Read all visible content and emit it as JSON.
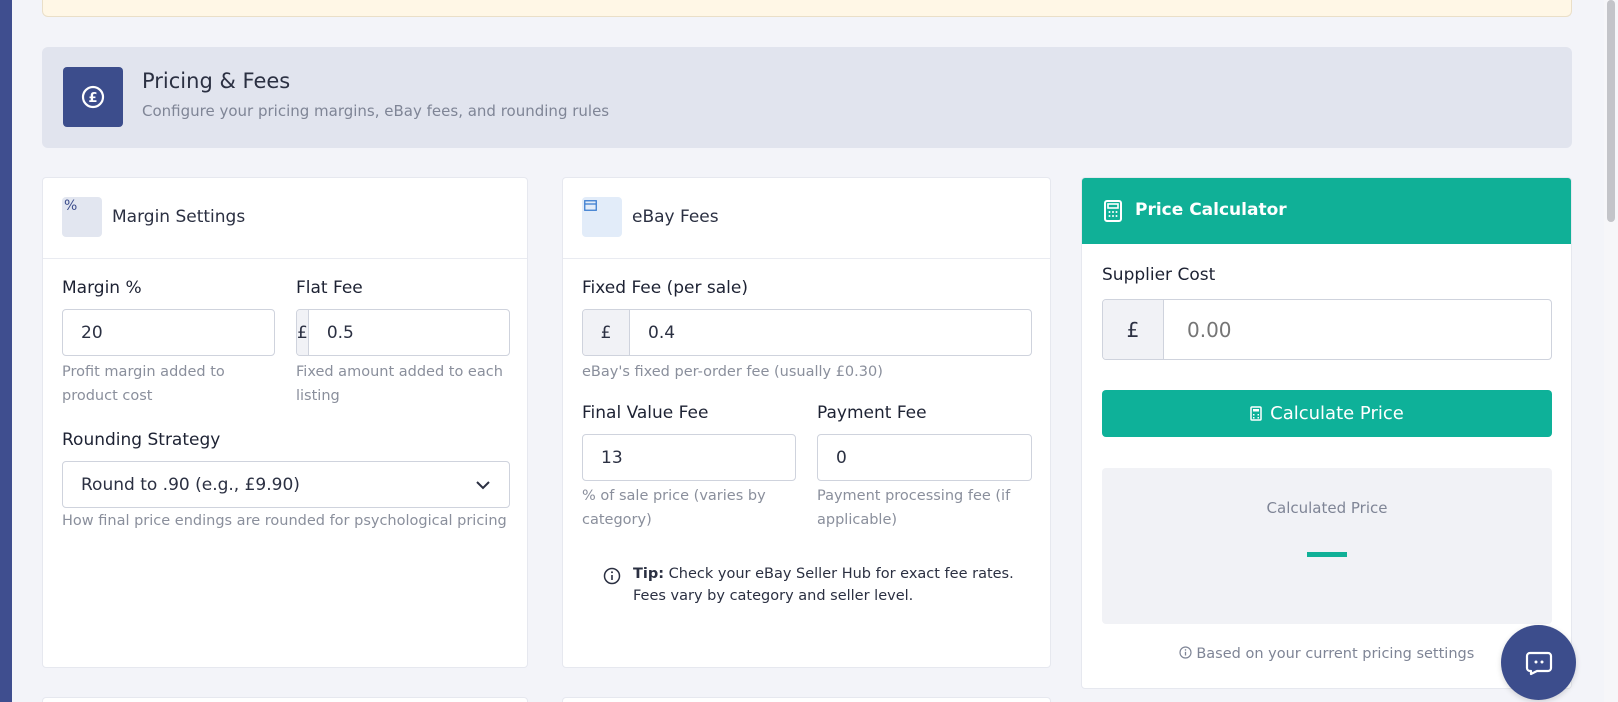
{
  "section": {
    "title": "Pricing & Fees",
    "subtitle": "Configure your pricing margins, eBay fees, and rounding rules",
    "icon": "pound-circle-icon"
  },
  "margin_card": {
    "icon_glyph": "%",
    "title": "Margin Settings",
    "margin_label": "Margin %",
    "margin_value": "20",
    "margin_suffix": "%",
    "margin_help": "Profit margin added to product cost",
    "flat_label": "Flat Fee",
    "flat_prefix": "£",
    "flat_value": "0.5",
    "flat_help": "Fixed amount added to each listing",
    "rounding_label": "Rounding Strategy",
    "rounding_selected": "Round to .90 (e.g., £9.90)",
    "rounding_help": "How final price endings are rounded for psychological pricing"
  },
  "ebay_card": {
    "title": "eBay Fees",
    "fixed_label": "Fixed Fee (per sale)",
    "fixed_prefix": "£",
    "fixed_value": "0.4",
    "fixed_help": "eBay's fixed per-order fee (usually £0.30)",
    "fvf_label": "Final Value Fee",
    "fvf_value": "13",
    "fvf_suffix": "%",
    "fvf_help": "% of sale price (varies by category)",
    "payment_label": "Payment Fee",
    "payment_value": "0",
    "payment_suffix": "%",
    "payment_help": "Payment processing fee (if applicable)",
    "tip_bold": "Tip:",
    "tip_text": " Check your eBay Seller Hub for exact fee rates. Fees vary by category and seller level."
  },
  "calculator": {
    "title": "Price Calculator",
    "supplier_label": "Supplier Cost",
    "supplier_prefix": "£",
    "supplier_placeholder": "0.00",
    "button_label": "Calculate Price",
    "result_label": "Calculated Price",
    "footnote": "Based on your current pricing settings"
  },
  "colors": {
    "accent": "#10b097",
    "brand": "#3c4d8c"
  }
}
